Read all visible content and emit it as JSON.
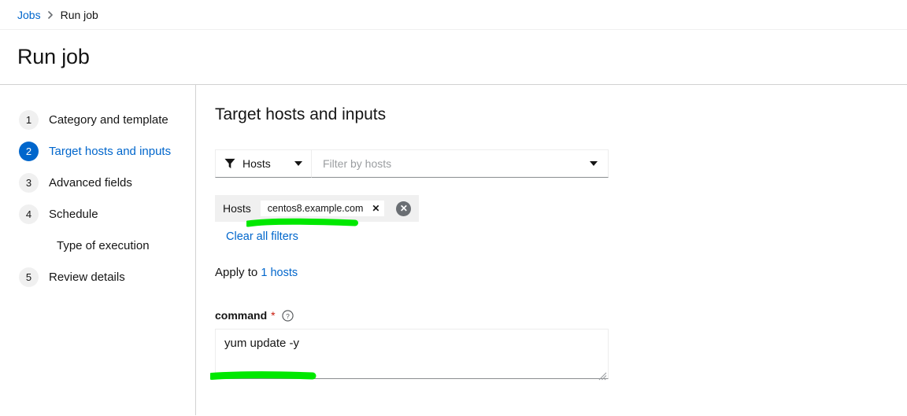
{
  "breadcrumb": {
    "root_label": "Jobs",
    "separator": "›",
    "current_label": "Run job"
  },
  "header": {
    "title": "Run job"
  },
  "wizard": {
    "steps": [
      {
        "number": "1",
        "label": "Category and template",
        "active": false,
        "sub": false
      },
      {
        "number": "2",
        "label": "Target hosts and inputs",
        "active": true,
        "sub": false
      },
      {
        "number": "3",
        "label": "Advanced fields",
        "active": false,
        "sub": false
      },
      {
        "number": "4",
        "label": "Schedule",
        "active": false,
        "sub": false
      },
      {
        "number": "",
        "label": "Type of execution",
        "active": false,
        "sub": true
      },
      {
        "number": "5",
        "label": "Review details",
        "active": false,
        "sub": false
      }
    ]
  },
  "main": {
    "section_title": "Target hosts and inputs",
    "filter": {
      "icon": "filter-funnel-icon",
      "select_label": "Hosts",
      "select_caret_icon": "caret-down-icon",
      "search_placeholder": "Filter by hosts",
      "search_value": "",
      "typeahead_caret_icon": "caret-down-icon"
    },
    "chip_group": {
      "label": "Hosts",
      "chips": [
        {
          "text": "centos8.example.com",
          "close_icon": "close-x-icon",
          "close_label": "✕"
        }
      ],
      "clear_group_icon": "circle-close-icon",
      "clear_group_label": "✕"
    },
    "clear_all_filters_label": "Clear all filters",
    "apply_to": {
      "prefix": "Apply to ",
      "count_label": "1 hosts"
    },
    "command_field": {
      "label": "command",
      "required_marker": "*",
      "help_icon": "help-circle-icon",
      "value": "yum update -y",
      "placeholder": "",
      "resize_grip_icon": "resize-grip-icon"
    }
  },
  "annotations": {
    "marker_color": "#00e800",
    "strokes": [
      {
        "name": "highlight-host-chip",
        "width": 139,
        "height": 11
      },
      {
        "name": "highlight-command-value",
        "width": 131,
        "height": 11
      }
    ]
  },
  "colors": {
    "link_blue": "#0066cc",
    "active_step_blue": "#0066cc",
    "required_red": "#c9190b",
    "chip_group_bg": "#f0f0f0",
    "clear_circle_gray": "#6a6e73",
    "marker_green": "#00e800"
  }
}
